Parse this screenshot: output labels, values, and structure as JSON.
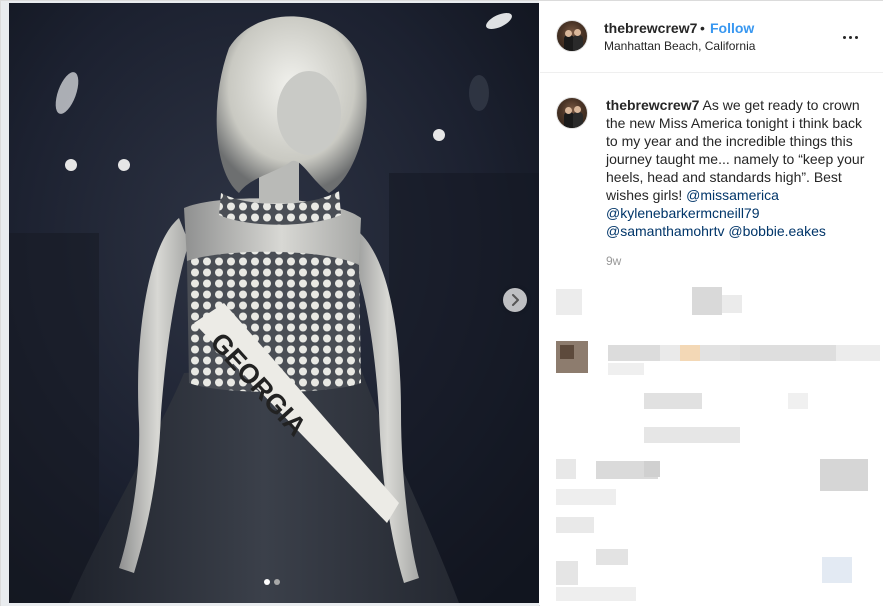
{
  "post": {
    "username": "thebrewcrew7",
    "separator": "•",
    "follow_label": "Follow",
    "location": "Manhattan Beach, California",
    "more_icon": "more-options-icon",
    "time_ago": "9w",
    "photo": {
      "sash_text": "GEORGIA",
      "carousel_count": 2,
      "carousel_active": 1
    }
  },
  "caption": {
    "username": "thebrewcrew7",
    "text_1": " As we get ready to crown the new Miss America tonight i think back to my year and the incredible things this journey taught me... namely to “keep your heels, head and standards high”. Best wishes girls! ",
    "mention_1": "@missamerica",
    "mention_2": "@kylenebarkermcneill79",
    "mention_3": "@samanthamohrtv",
    "mention_4": "@bobbie.eakes"
  },
  "colors": {
    "link_blue": "#3897f0",
    "mention_blue": "#003569",
    "meta_gray": "#999999",
    "border": "#dbdbdb"
  }
}
